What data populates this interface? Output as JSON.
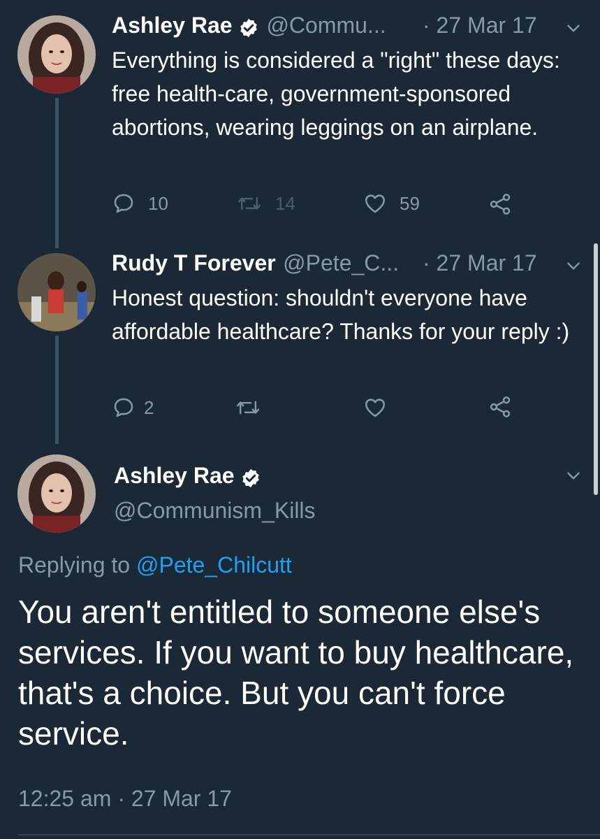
{
  "tweets": [
    {
      "name": "Ashley Rae",
      "handle": "@Commu...",
      "date": "· 27 Mar 17",
      "text": "Everything is considered a \"right\" these days: free health-care, government-sponsored abortions, wearing leggings on an airplane.",
      "replies": "10",
      "retweets": "14",
      "likes": "59"
    },
    {
      "name": "Rudy T Forever",
      "handle": "@Pete_C...",
      "date": "· 27 Mar 17",
      "text": "Honest question: shouldn't everyone have affordable healthcare? Thanks for your reply :)",
      "replies": "2"
    }
  ],
  "main_tweet": {
    "name": "Ashley Rae",
    "handle": "@Communism_Kills",
    "replying_prefix": "Replying to",
    "replying_handle": "@Pete_Chilcutt",
    "text": "You aren't entitled to someone else's services. If you want to buy healthcare, that's a choice. But you can't force service.",
    "timestamp": "12:25 am · 27 Mar 17"
  },
  "colors": {
    "background": "#1b2836",
    "secondary_text": "#8899a6",
    "link": "#1da1f2",
    "thread_line": "#3d5466"
  },
  "icons": [
    "reply-icon",
    "retweet-icon",
    "like-icon",
    "share-icon",
    "chevron-down-icon",
    "verified-badge-icon"
  ]
}
